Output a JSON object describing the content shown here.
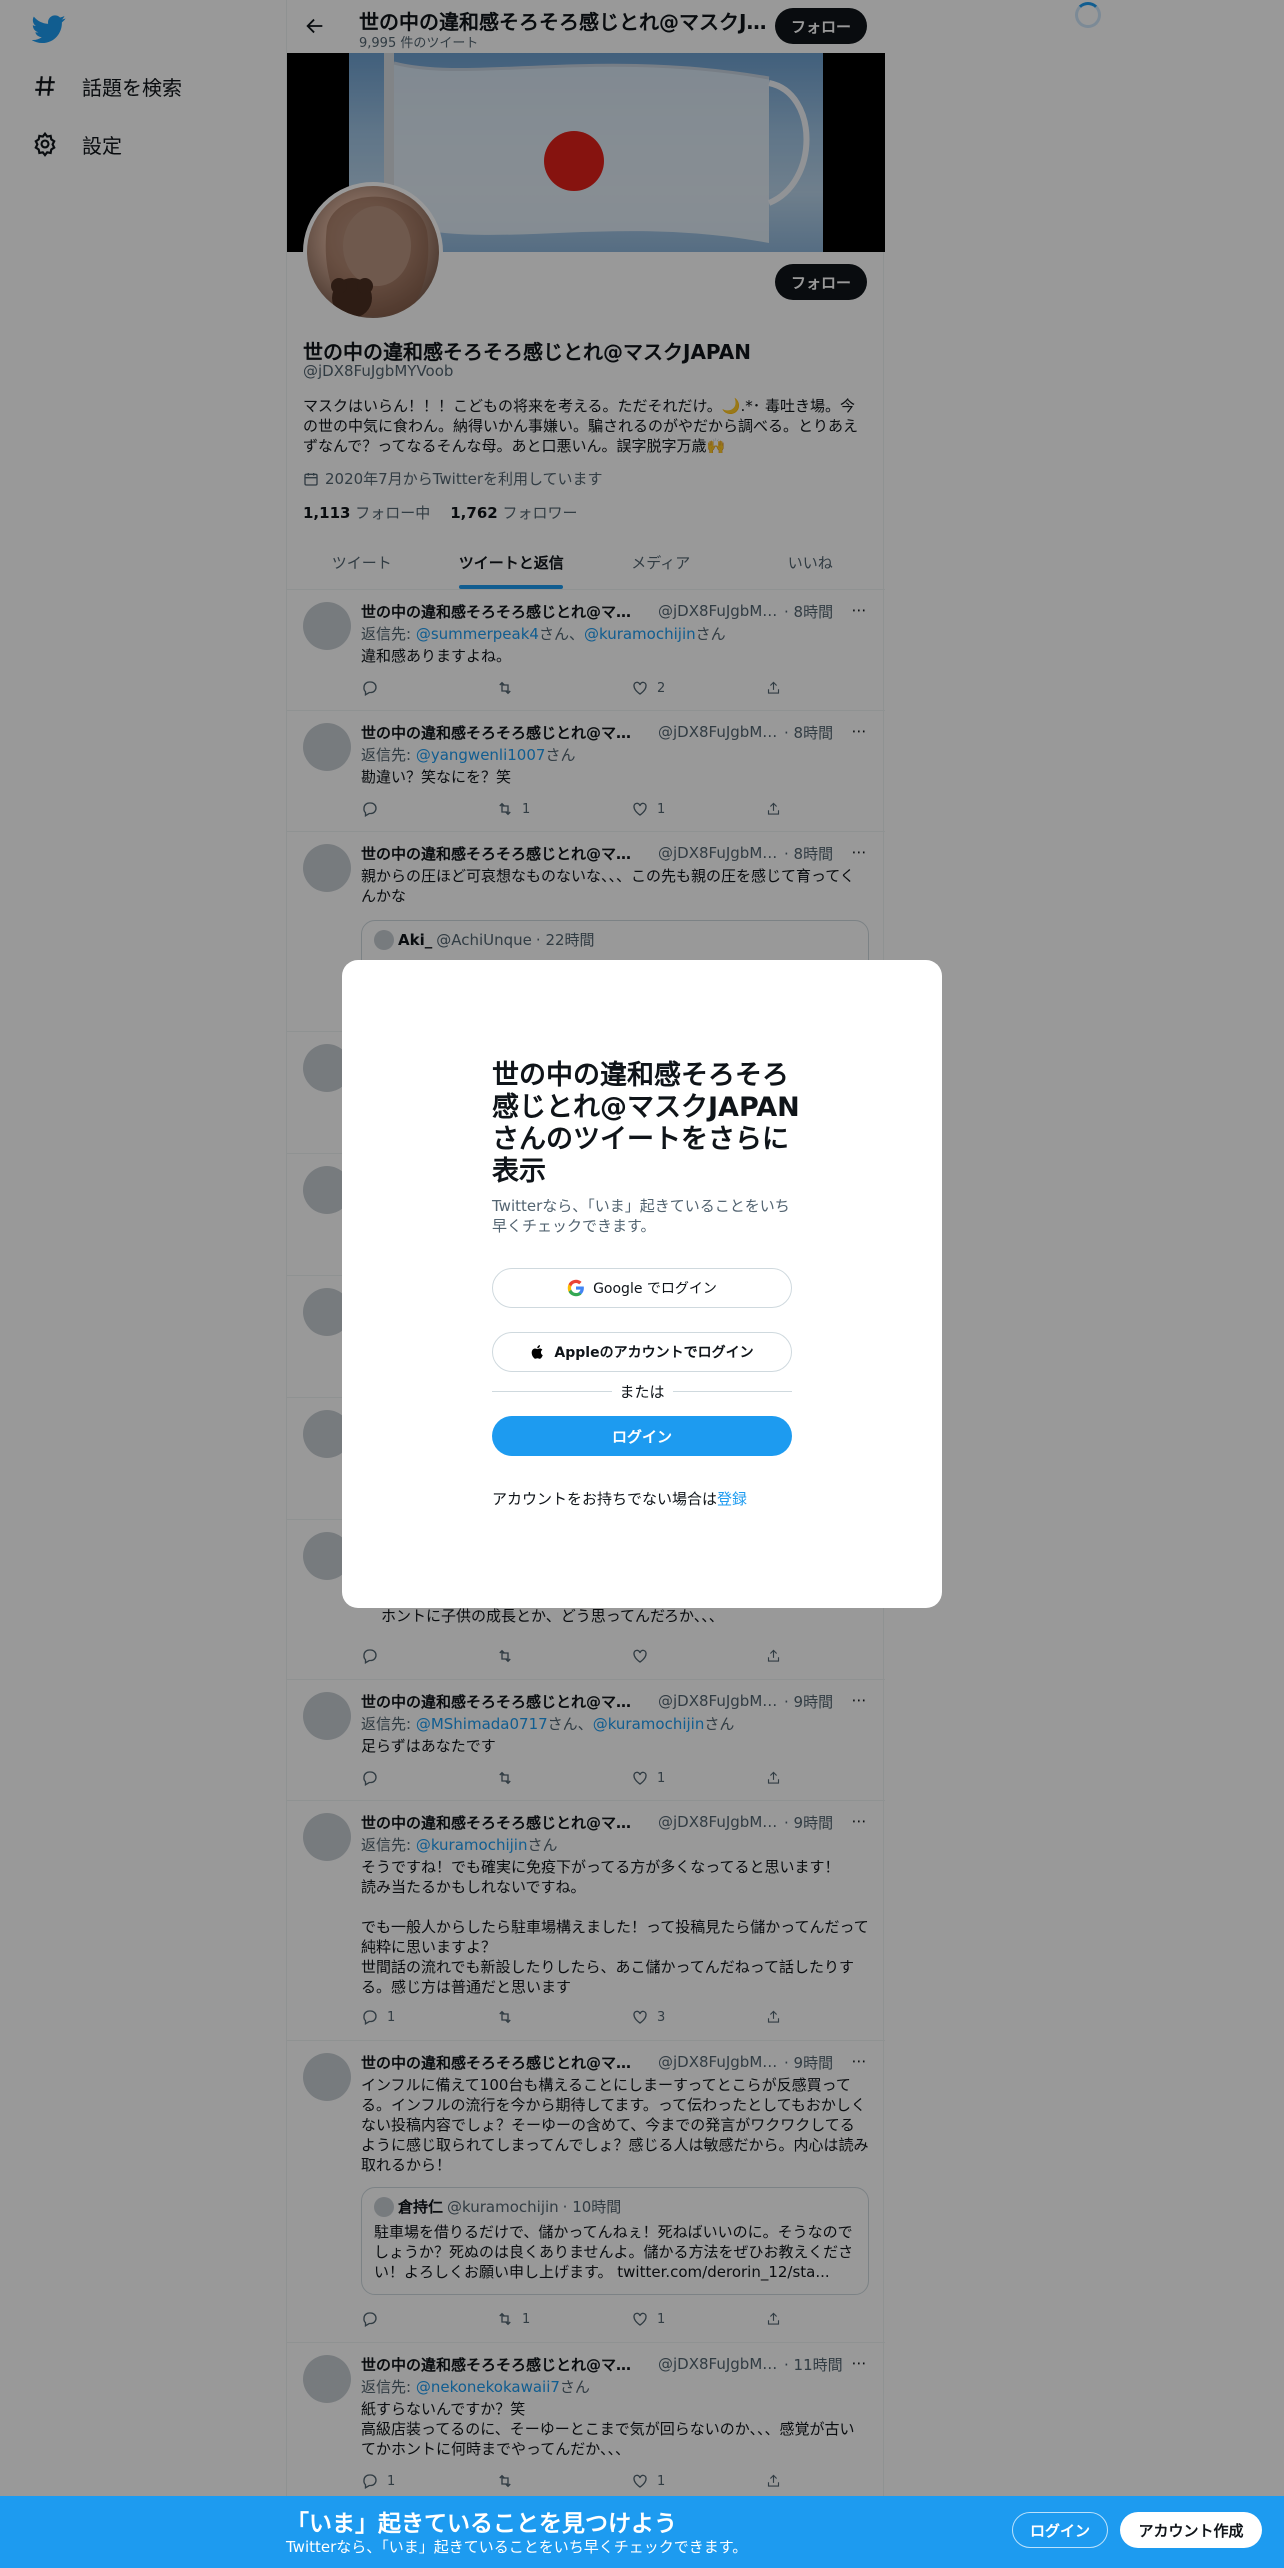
{
  "nav": {
    "explore_label": "話題を検索",
    "settings_label": "設定"
  },
  "topbar": {
    "title": "世の中の違和感そろそろ感じとれ@マスクJAPAN",
    "subtitle": "9,995 件のツイート",
    "follow_label": "フォロー"
  },
  "profile": {
    "follow_label": "フォロー",
    "name": "世の中の違和感そろそろ感じとれ@マスクJAPAN",
    "handle": "@jDX8FuJgbMYVoob",
    "bio": "マスクはいらん！！！こどもの将来を考える。ただそれだけ。🌙.*･ 毒吐き場。今の世の中気に食わん。納得いかん事嫌い。騙されるのがやだから調べる。とりあえずなんで？ってなるそんな母。あと口悪いん。誤字脱字万歳🙌",
    "joined": "2020年7月からTwitterを利用しています",
    "following_count": "1,113",
    "following_label": "フォロー中",
    "followers_count": "1,762",
    "followers_label": "フォロワー"
  },
  "tabs": [
    "ツイート",
    "ツイートと返信",
    "メディア",
    "いいね"
  ],
  "tweets": [
    {
      "name": "世の中の違和感そろそろ感じとれ@マスクJAPAN",
      "handle": "@jDX8FuJgbMYVoob",
      "time": "· 8時間",
      "reply_prefix": "返信先: ",
      "reply_user1": "@summerpeak4",
      "reply_mid": "さん、",
      "reply_user2": "@kuramochijin",
      "reply_suffix": "さん",
      "text": "違和感ありますよね。",
      "reply_count": "",
      "retweet_count": "",
      "like_count": "2"
    },
    {
      "name": "世の中の違和感そろそろ感じとれ@マスクJAPAN",
      "handle": "@jDX8FuJgbMYVoob",
      "time": "· 8時間",
      "reply_prefix": "返信先: ",
      "reply_user1": "@yangwenli1007",
      "reply_suffix": "さん",
      "text": "勘違い？笑なにを？笑",
      "reply_count": "",
      "retweet_count": "1",
      "like_count": "1"
    },
    {
      "name": "世の中の違和感そろそろ感じとれ@マスクJAPAN",
      "handle": "@jDX8FuJgbMYVoob",
      "time": "· 8時間",
      "text": "親からの圧ほど可哀想なものないな、、、この先も親の圧を感じて育ってくんかな",
      "quote_name": "Aki_",
      "quote_handle": "@AchiUnque",
      "quote_time": "· 22時間"
    },
    {
      "text": "ホントに子供の成長とか、どう思ってんだろか、、、",
      "reply_count": "",
      "retweet_count": "",
      "like_count": ""
    },
    {
      "name": "世の中の違和感そろそろ感じとれ@マスクJAPAN",
      "handle": "@jDX8FuJgbMYVoob",
      "time": "· 9時間",
      "reply_prefix": "返信先: ",
      "reply_user1": "@MShimada0717",
      "reply_mid": "さん、",
      "reply_user2": "@kuramochijin",
      "reply_suffix": "さん",
      "text": "足らずはあなたです",
      "reply_count": "",
      "retweet_count": "",
      "like_count": "1"
    },
    {
      "name": "世の中の違和感そろそろ感じとれ@マスクJAPAN",
      "handle": "@jDX8FuJgbMYVoob",
      "time": "· 9時間",
      "reply_prefix": "返信先: ",
      "reply_user1": "@kuramochijin",
      "reply_suffix": "さん",
      "text": "そうですね！でも確実に免疫下がってる方が多くなってると思います！\n読み当たるかもしれないですね。\n\nでも一般人からしたら駐車場構えました！って投稿見たら儲かってんだって純粋に思いますよ？\n世間話の流れでも新設したりしたら、あこ儲かってんだねって話したりする。感じ方は普通だと思います",
      "reply_count": "1",
      "retweet_count": "",
      "like_count": "3"
    },
    {
      "name": "世の中の違和感そろそろ感じとれ@マスクJAPAN",
      "handle": "@jDX8FuJgbMYVoob",
      "time": "· 9時間",
      "text": "インフルに備えて100台も構えることにしまーすってとこらが反感買ってる。インフルの流行を今から期待してます。って伝わったとしてもおかしくない投稿内容でしょ？そーゆーの含めて、今までの発言がワクワクしてるように感じ取られてしまってんでしょ？感じる人は敏感だから。内心は読み取れるから！",
      "quote_name": "倉持仁",
      "quote_handle": "@kuramochijin",
      "quote_time": "· 10時間",
      "quote_text": "駐車場を借りるだけで、儲かってんねぇ！死ねばいいのに。そうなのでしょうか？死ぬのは良くありませんよ。儲かる方法をぜひお教えください！よろしくお願い申し上げます。 twitter.com/derorin_12/sta...",
      "reply_count": "",
      "retweet_count": "1",
      "like_count": "1"
    },
    {
      "name": "世の中の違和感そろそろ感じとれ@マスクJAPAN",
      "handle": "@jDX8FuJgbMYVoob",
      "time": "· 11時間",
      "reply_prefix": "返信先: ",
      "reply_user1": "@nekonekokawaii7",
      "reply_suffix": "さん",
      "text": "紙すらないんですか？笑\n高級店装ってるのに、そーゆーとこまで気が回らないのか、、、感覚が古いてかホントに何時までやってんだか、、、",
      "reply_count": "1",
      "retweet_count": "",
      "like_count": "1"
    }
  ],
  "modal": {
    "title": "世の中の違和感そろそろ感じとれ@マスクJAPANさんのツイートをさらに表示",
    "subtitle": "Twitterなら、「いま」起きていることをいち早くチェックできます。",
    "google_label": "Google でログイン",
    "apple_label": "Appleのアカウントでログイン",
    "or_label": "または",
    "login_label": "ログイン",
    "signup_prefix": "アカウントをお持ちでない場合は",
    "signup_link": "登録"
  },
  "bottombar": {
    "title": "「いま」起きていることを見つけよう",
    "subtitle": "Twitterなら、「いま」起きていることをいち早くチェックできます。",
    "login_label": "ログイン",
    "signup_label": "アカウント作成"
  },
  "colors": {
    "accent": "#1d9bf0",
    "text": "#0f1419",
    "muted": "#536471",
    "overlay": "rgba(0,0,0,0.4)"
  },
  "icons": [
    "twitter-logo-icon",
    "hashtag-icon",
    "gear-icon",
    "back-arrow-icon",
    "more-icon",
    "reply-icon",
    "retweet-icon",
    "like-icon",
    "share-icon",
    "calendar-icon",
    "google-icon",
    "apple-icon"
  ]
}
